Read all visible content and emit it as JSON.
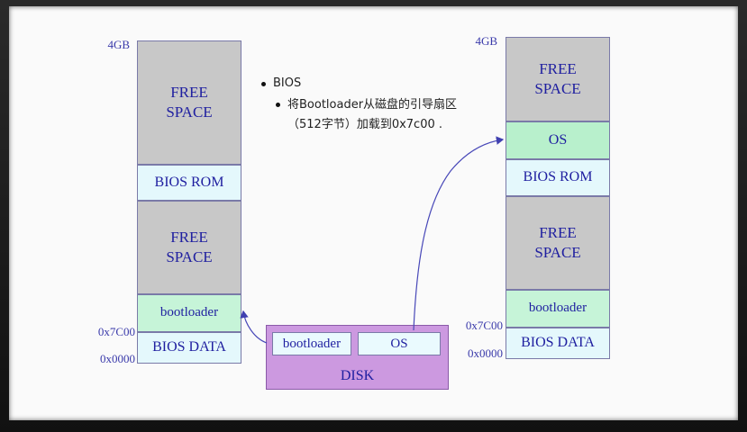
{
  "left_stack": {
    "top_label": "4GB",
    "free_top": "FREE\nSPACE",
    "bios_rom": "BIOS ROM",
    "free_mid": "FREE\nSPACE",
    "bootloader": "bootloader",
    "bios_data": "BIOS DATA",
    "addr_7c00": "0x7C00",
    "addr_0000": "0x0000"
  },
  "right_stack": {
    "top_label": "4GB",
    "free_top": "FREE\nSPACE",
    "os": "OS",
    "bios_rom": "BIOS ROM",
    "free_mid": "FREE\nSPACE",
    "bootloader": "bootloader",
    "bios_data": "BIOS DATA",
    "addr_7c00": "0x7C00",
    "addr_0000": "0x0000"
  },
  "disk": {
    "bootloader": "bootloader",
    "os": "OS",
    "label": "DISK"
  },
  "text": {
    "bullet1": "BIOS",
    "bullet2_line1": "将Bootloader从磁盘的引导扇区",
    "bullet2_line2": "（512字节）加载到0x7c00 ."
  },
  "colors": {
    "free_space": "#c8c8c8",
    "rom_data": "#e4f8fc",
    "bootloader": "#c6f4d8",
    "disk": "#cc99e0",
    "text_blue": "#1f1fa0"
  }
}
